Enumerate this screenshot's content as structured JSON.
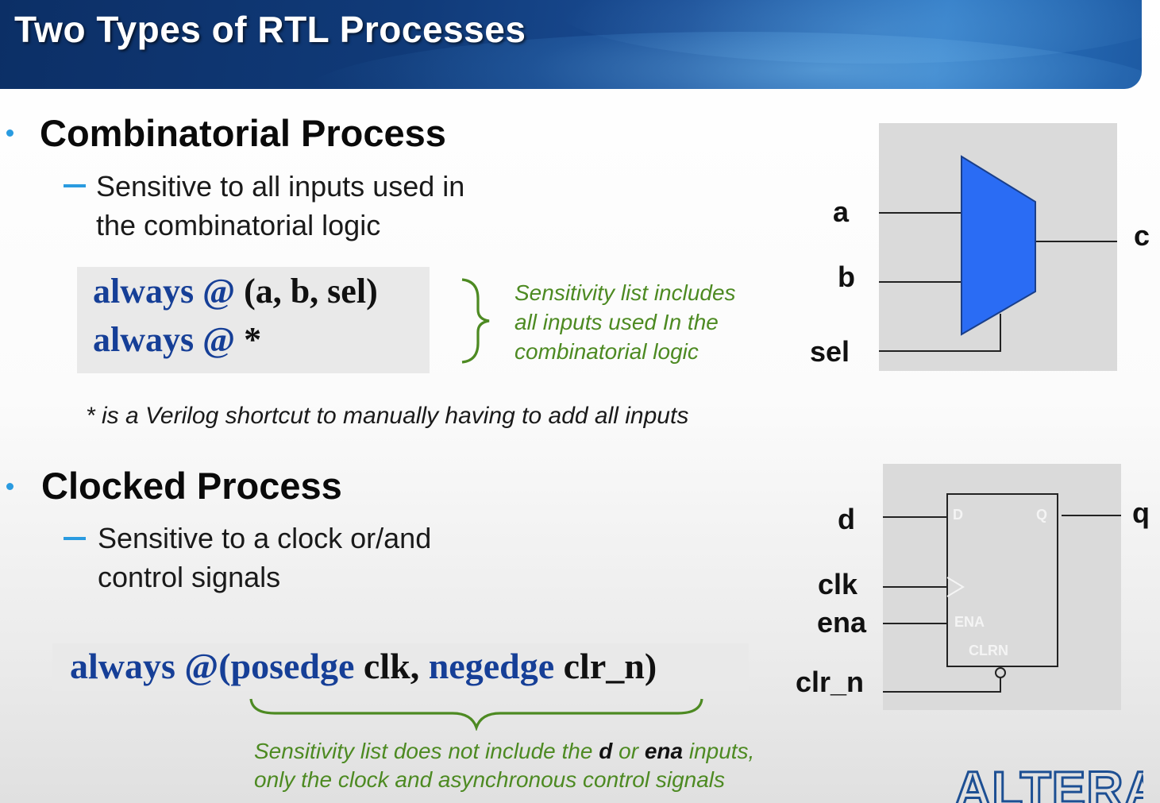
{
  "slide": {
    "title": "Two Types of RTL Processes"
  },
  "combinatorial": {
    "heading": "Combinatorial Process",
    "sub_line1": "Sensitive to all inputs used in",
    "sub_line2": "the combinatorial logic",
    "code_line1_kw1": "always",
    "code_line1_at": "@",
    "code_line1_rest": "(a, b, sel)",
    "code_line2_kw1": "always",
    "code_line2_at": "@",
    "code_line2_rest": "*",
    "note_line1": "Sensitivity list includes",
    "note_line2": "all inputs used In the",
    "note_line3": "combinatorial logic",
    "footnote": "* is a Verilog shortcut to manually having to add all inputs",
    "signals": {
      "a": "a",
      "b": "b",
      "sel": "sel",
      "c": "c"
    }
  },
  "clocked": {
    "heading": "Clocked Process",
    "sub_line1": "Sensitive to a clock or/and",
    "sub_line2": "control signals",
    "code_kw1": "always",
    "code_at": "@(",
    "code_kw2": "posedge",
    "code_mid": "clk,",
    "code_kw3": "negedge",
    "code_end": "clr_n)",
    "note_part1": "Sensitivity list does not include the",
    "note_bold1": "d",
    "note_part2": "or",
    "note_bold2": "ena",
    "note_part3": "inputs,",
    "note_line2": "only the clock and asynchronous control signals",
    "signals": {
      "d": "d",
      "clk": "clk",
      "ena": "ena",
      "clr_n": "clr_n",
      "q": "q"
    },
    "ff_pins": {
      "d": "D",
      "q": "Q",
      "ena": "ENA",
      "clrn": "CLRN"
    }
  },
  "logo": {
    "text": "ALTERA."
  },
  "colors": {
    "bullet": "#2a9be0",
    "keyword": "#163f97",
    "note": "#4d8a22",
    "mux_fill": "#2a6cf4"
  }
}
